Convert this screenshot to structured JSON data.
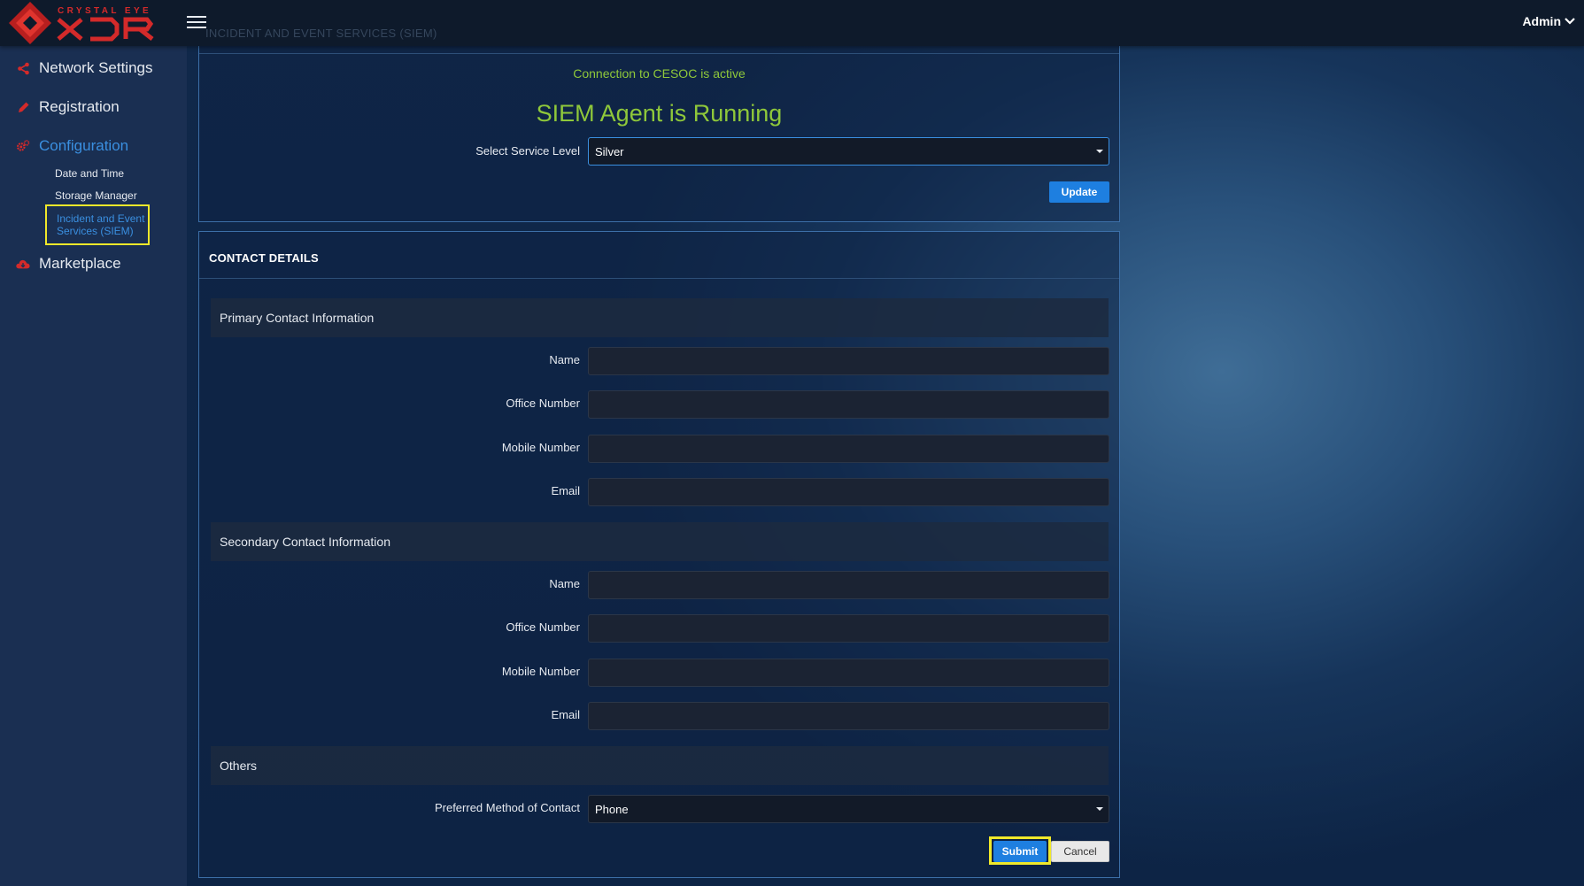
{
  "brand": {
    "logo_small_text": "CRYSTAL EYE",
    "logo_big_text": "XDR"
  },
  "header": {
    "user_label": "Admin",
    "page_title": "INCIDENT AND EVENT SERVICES (SIEM)"
  },
  "sidebar": {
    "items": [
      {
        "label": "Network Settings",
        "icon": "share-icon"
      },
      {
        "label": "Registration",
        "icon": "pencil-icon"
      },
      {
        "label": "Configuration",
        "icon": "gears-icon"
      },
      {
        "label": "Marketplace",
        "icon": "cloud-download-icon"
      }
    ],
    "config_sub": [
      {
        "label": "Date and Time"
      },
      {
        "label": "Storage Manager"
      },
      {
        "label": "Incident and Event Services (SIEM)"
      }
    ]
  },
  "siem": {
    "connection_status": "Connection to CESOC is active",
    "agent_status": "SIEM Agent is Running",
    "service_level_label": "Select Service Level",
    "service_level_value": "Silver",
    "update_label": "Update"
  },
  "contact": {
    "title": "CONTACT DETAILS",
    "primary_title": "Primary Contact Information",
    "secondary_title": "Secondary Contact Information",
    "others_title": "Others",
    "fields": {
      "name": "Name",
      "office": "Office Number",
      "mobile": "Mobile Number",
      "email": "Email"
    },
    "preferred_label": "Preferred Method of Contact",
    "preferred_value": "Phone",
    "submit_label": "Submit",
    "cancel_label": "Cancel"
  },
  "colors": {
    "accent": "#1e7fe0",
    "status_green": "#8fc83a",
    "highlight": "#f0e82a",
    "brand_red": "#d42a2a"
  }
}
